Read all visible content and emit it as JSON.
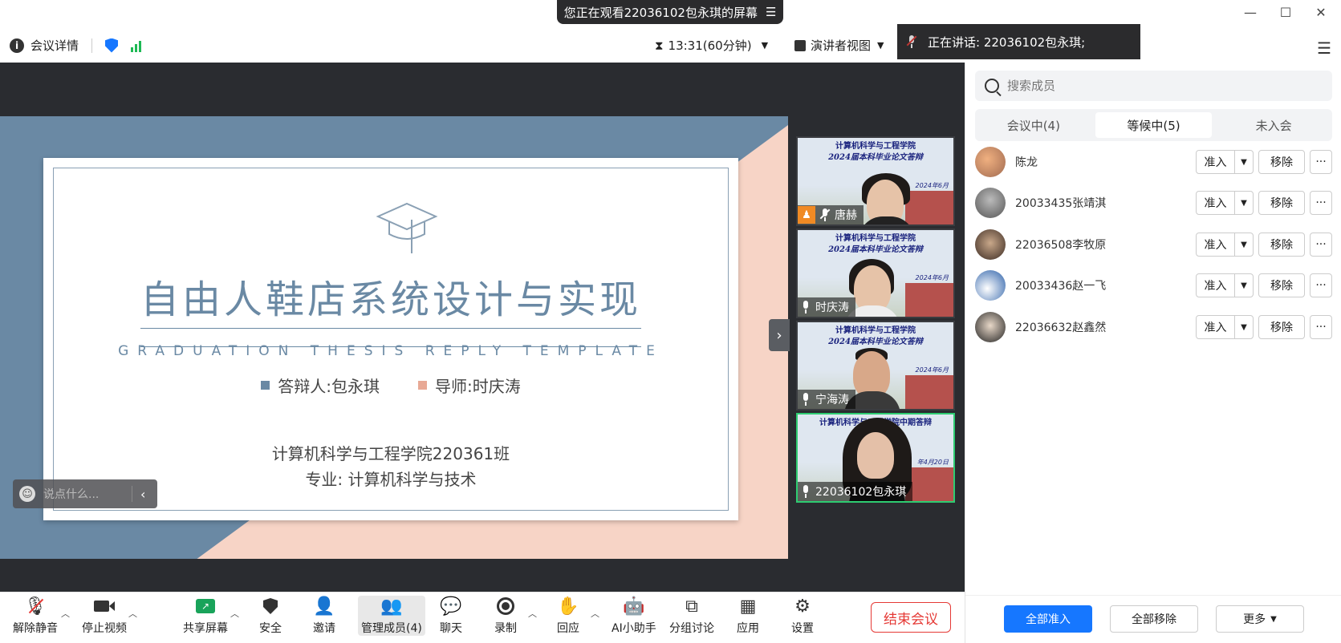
{
  "banner": {
    "text": "您正在观看22036102包永琪的屏幕"
  },
  "topbar": {
    "meeting_info": "会议详情",
    "timer": "13:31(60分钟)",
    "view_mode": "演讲者视图",
    "speaking": "正在讲话:  22036102包永琪;"
  },
  "slide": {
    "title": "自由人鞋店系统设计与实现",
    "subtitle": "GRADUATION THESIS REPLY TEMPLATE",
    "defender": "答辩人:包永琪",
    "advisor": "导师:时庆涛",
    "school": "计算机科学与工程学院220361班",
    "major": "专业:  计算机科学与技术"
  },
  "chat": {
    "placeholder": "说点什么..."
  },
  "gallery": {
    "tiles": [
      {
        "name": "唐赫",
        "head1": "计算机科学与工程学院",
        "head2": "2024届本科毕业论文答辩",
        "date": "2024年6月"
      },
      {
        "name": "时庆涛",
        "head1": "计算机科学与工程学院",
        "head2": "2024届本科毕业论文答辩",
        "date": "2024年6月"
      },
      {
        "name": "宁海涛",
        "head1": "计算机科学与工程学院",
        "head2": "2024届本科毕业论文答辩",
        "date": "2024年6月"
      },
      {
        "name": "22036102包永琪",
        "head1": "计算机科学与工程学院中期答辩",
        "head2": "",
        "date": "年4月20日"
      }
    ]
  },
  "toolbar": {
    "unmute": "解除静音",
    "stop_video": "停止视频",
    "share": "共享屏幕",
    "security": "安全",
    "invite": "邀请",
    "manage": "管理成员(4)",
    "chat": "聊天",
    "record": "录制",
    "react": "回应",
    "ai": "AI小助手",
    "breakout": "分组讨论",
    "apps": "应用",
    "settings": "设置",
    "end": "结束会议"
  },
  "panel": {
    "search_placeholder": "搜索成员",
    "tabs": [
      "会议中(4)",
      "等候中(5)",
      "未入会"
    ],
    "members": [
      {
        "name": "陈龙"
      },
      {
        "name": "20033435张靖淇"
      },
      {
        "name": "22036508李牧原"
      },
      {
        "name": "20033436赵一飞"
      },
      {
        "name": "22036632赵鑫然"
      }
    ],
    "admit_label": "准入",
    "remove_label": "移除",
    "more_label": "···",
    "admit_all": "全部准入",
    "remove_all": "全部移除",
    "more_menu": "更多"
  },
  "colors": {
    "accent": "#1677ff",
    "end": "#e53935",
    "slide_blue": "#6a89a4",
    "slide_pink": "#f7d4c6"
  }
}
